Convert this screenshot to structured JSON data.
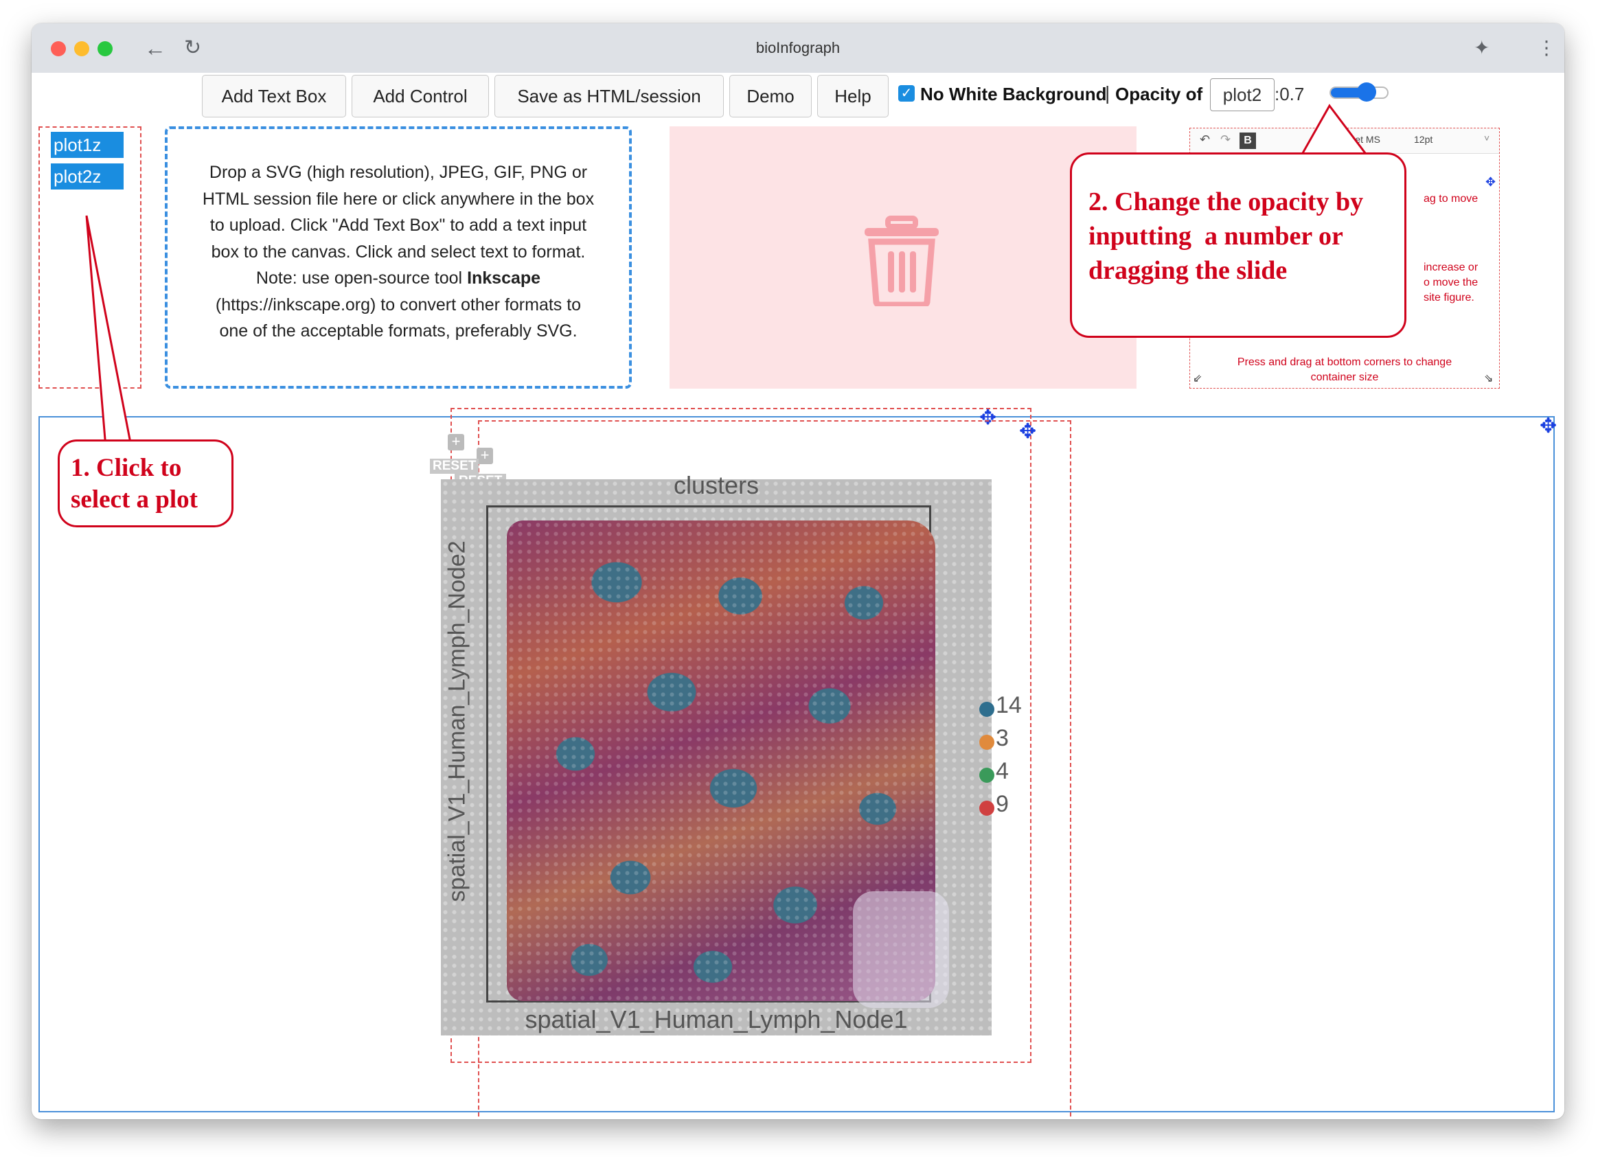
{
  "window": {
    "title": "bioInfograph"
  },
  "toolbar": {
    "add_text_box": "Add Text Box",
    "add_control": "Add Control",
    "save": "Save as HTML/session",
    "demo": "Demo",
    "help": "Help",
    "no_white_bg_label": "No White Background",
    "separator": "|",
    "opacity_label": "Opacity of",
    "opacity_target": "plot2",
    "opacity_value": ":0.7",
    "slider_value": 0.7
  },
  "plot_list": {
    "items": [
      "plot1z",
      "plot2z"
    ]
  },
  "dropzone": {
    "line1": "Drop a SVG (high resolution), JPEG, GIF, PNG or",
    "line2": "HTML session file here or click anywhere in the box",
    "line3": "to upload. Click \"Add Text Box\" to add a text input",
    "line4": "box to the canvas. Click and select text to format.",
    "line5_prefix": "Note: use open-source tool ",
    "line5_bold": "Inkscape",
    "line6": "(https://inkscape.org) to convert other formats to",
    "line7": "one of the acceptable formats, preferably SVG."
  },
  "preview": {
    "font_name": "buchet MS",
    "font_size": "12pt",
    "bold_btn": "B",
    "text_drag": "ag to move",
    "text_increase": "increase or",
    "text_move": "o move the",
    "text_figure": "site figure.",
    "text_press": "Press and drag at bottom corners to change",
    "text_container": "container size"
  },
  "callouts": {
    "one_line1": "1. Click to",
    "one_line2": "select a plot",
    "two_line1": "2. Change the opacity by",
    "two_line2": "inputting  a number or",
    "two_line3": "dragging the slide"
  },
  "canvas": {
    "reset1": "RESET",
    "reset2": "RESET",
    "plot_title": "clusters",
    "xlabel": "spatial_V1_Human_Lymph_Node1",
    "ylabel": "spatial_V1_Human_Lymph_Node2",
    "legend": [
      {
        "label": "14",
        "color": "#2e6e8e"
      },
      {
        "label": "3",
        "color": "#e08a3c"
      },
      {
        "label": "4",
        "color": "#3a9a5a"
      },
      {
        "label": "9",
        "color": "#d04040"
      }
    ]
  },
  "colors": {
    "accent_blue": "#1a8de0",
    "callout_red": "#d0021b",
    "trash_pink": "#f5a0a8"
  }
}
